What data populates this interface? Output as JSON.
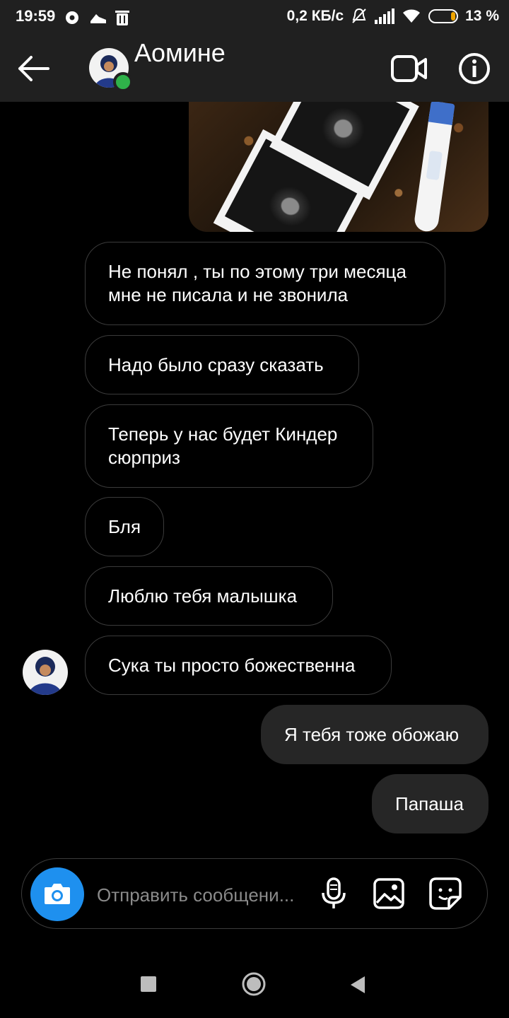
{
  "status_bar": {
    "time": "19:59",
    "network_speed": "0,2 КБ/с",
    "battery": "13 %",
    "battery_color": "#f0a500"
  },
  "header": {
    "contact_name": "Аомине",
    "online": true,
    "icons": [
      "back-arrow-icon",
      "video-call-icon",
      "info-icon"
    ]
  },
  "messages": [
    {
      "sender": "them",
      "text": "Не понял , ты по этому три месяца мне не писала и не звонила"
    },
    {
      "sender": "them",
      "text": "Надо было сразу сказать"
    },
    {
      "sender": "them",
      "text": "Теперь у нас будет Киндер сюрприз"
    },
    {
      "sender": "them",
      "text": "Бля"
    },
    {
      "sender": "them",
      "text": "Люблю тебя малышка"
    },
    {
      "sender": "them",
      "text": "Сука ты просто божественна"
    },
    {
      "sender": "me",
      "text": "Я тебя тоже обожаю"
    },
    {
      "sender": "me",
      "text": "Папаша"
    }
  ],
  "composer": {
    "placeholder": "Отправить сообщени...",
    "icons": [
      "camera-icon",
      "microphone-icon",
      "gallery-icon",
      "sticker-icon"
    ],
    "camera_color": "#1e90ef"
  },
  "nav_bar": {
    "icons": [
      "recents-icon",
      "home-icon",
      "back-icon"
    ]
  }
}
